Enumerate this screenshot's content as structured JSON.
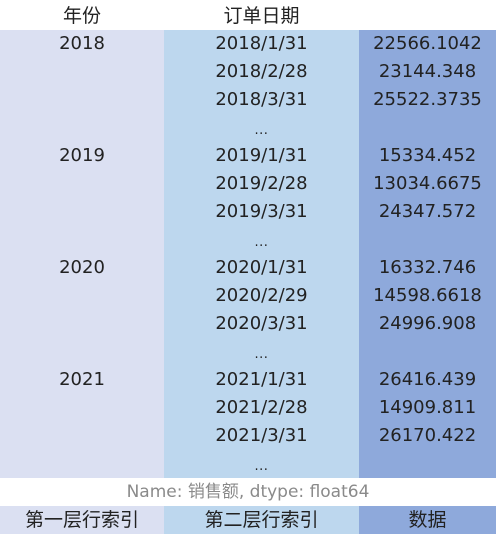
{
  "header": {
    "year_label": "年份",
    "date_label": "订单日期"
  },
  "rows": [
    {
      "year": "2018",
      "date": "2018/1/31",
      "value": "22566.1042"
    },
    {
      "year": "",
      "date": "2018/2/28",
      "value": "23144.348"
    },
    {
      "year": "",
      "date": "2018/3/31",
      "value": "25522.3735"
    },
    {
      "year": "",
      "date": "...",
      "value": ""
    },
    {
      "year": "2019",
      "date": "2019/1/31",
      "value": "15334.452"
    },
    {
      "year": "",
      "date": "2019/2/28",
      "value": "13034.6675"
    },
    {
      "year": "",
      "date": "2019/3/31",
      "value": "24347.572"
    },
    {
      "year": "",
      "date": "...",
      "value": ""
    },
    {
      "year": "2020",
      "date": "2020/1/31",
      "value": "16332.746"
    },
    {
      "year": "",
      "date": "2020/2/29",
      "value": "14598.6618"
    },
    {
      "year": "",
      "date": "2020/3/31",
      "value": "24996.908"
    },
    {
      "year": "",
      "date": "...",
      "value": ""
    },
    {
      "year": "2021",
      "date": "2021/1/31",
      "value": "26416.439"
    },
    {
      "year": "",
      "date": "2021/2/28",
      "value": "14909.811"
    },
    {
      "year": "",
      "date": "2021/3/31",
      "value": "26170.422"
    },
    {
      "year": "",
      "date": "...",
      "value": ""
    }
  ],
  "info": "Name: 销售额, dtype: float64",
  "legend": {
    "first_level": "第一层行索引",
    "second_level": "第二层行索引",
    "data": "数据"
  },
  "colors": {
    "first_level_bg": "#dbe0f2",
    "second_level_bg": "#bdd7ee",
    "data_bg": "#8ea9db"
  }
}
